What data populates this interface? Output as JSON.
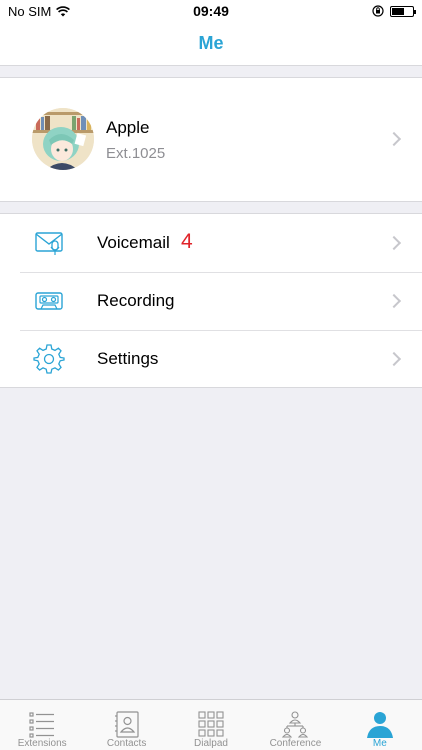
{
  "status_bar": {
    "carrier": "No SIM",
    "time": "09:49",
    "battery_level": 0.55,
    "icons": [
      "wifi-icon",
      "rotation-lock-icon",
      "battery-icon"
    ]
  },
  "nav": {
    "title": "Me"
  },
  "profile": {
    "name": "Apple",
    "extension": "Ext.1025",
    "avatar": "anime-character-avatar"
  },
  "menu": {
    "items": [
      {
        "label": "Voicemail",
        "badge": "4",
        "icon": "voicemail-icon"
      },
      {
        "label": "Recording",
        "badge": "",
        "icon": "recording-icon"
      },
      {
        "label": "Settings",
        "badge": "",
        "icon": "gear-icon"
      }
    ]
  },
  "tabs": [
    {
      "label": "Extensions",
      "icon": "list-icon",
      "active": false
    },
    {
      "label": "Contacts",
      "icon": "contacts-book-icon",
      "active": false
    },
    {
      "label": "Dialpad",
      "icon": "dialpad-icon",
      "active": false
    },
    {
      "label": "Conference",
      "icon": "conference-icon",
      "active": false
    },
    {
      "label": "Me",
      "icon": "person-icon",
      "active": true
    }
  ],
  "colors": {
    "accent": "#2aa4d5",
    "badge": "#e0242a",
    "background": "#efeff4",
    "inactive_tab": "#929292"
  }
}
